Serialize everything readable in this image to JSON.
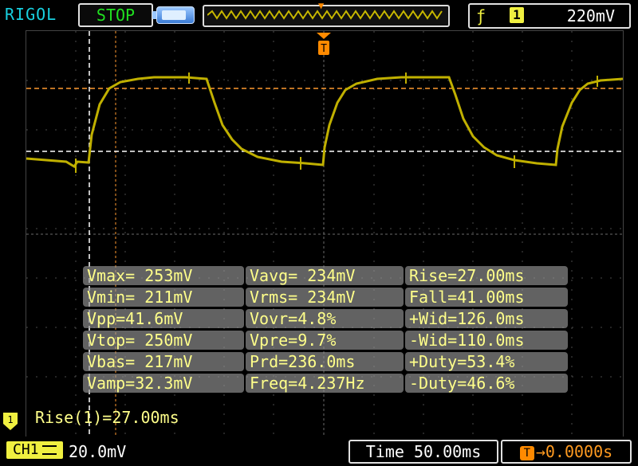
{
  "header": {
    "brand": "RIGOL",
    "status": "STOP",
    "trigger_channel": "1",
    "trigger_level": "220mV"
  },
  "colors": {
    "trace": "#c0b000",
    "accent": "#ff8a00",
    "brand": "#18d0e0",
    "status": "#20e020"
  },
  "icons": [
    "battery-icon",
    "trigger-edge-icon",
    "trigger-marker-icon",
    "channel-marker-icon"
  ],
  "measurements": [
    [
      "Vmax= 253mV",
      "Vavg= 234mV",
      "Rise=27.00ms"
    ],
    [
      "Vmin= 211mV",
      "Vrms= 234mV",
      "Fall=41.00ms"
    ],
    [
      "Vpp=41.6mV",
      "Vovr=4.8%",
      "+Wid=126.0ms"
    ],
    [
      "Vtop= 250mV",
      "Vpre=9.7%",
      "-Wid=110.0ms"
    ],
    [
      "Vbas= 217mV",
      "Prd=236.0ms",
      "+Duty=53.4%"
    ],
    [
      "Vamp=32.3mV",
      "Freq=4.237Hz",
      "-Duty=46.6%"
    ]
  ],
  "cursor_readout": "Rise(1)=27.00ms",
  "footer": {
    "channel": "CH1",
    "scale": "20.0mV",
    "time": "Time 50.00ms",
    "trigger_offset": "0.0000s"
  }
}
